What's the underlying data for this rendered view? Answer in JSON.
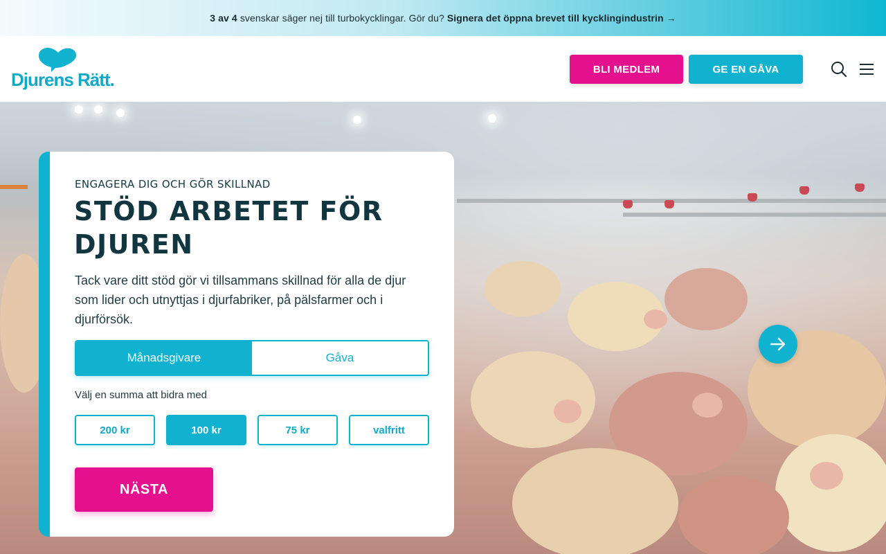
{
  "banner": {
    "lead_bold": "3 av 4",
    "lead_text": "svenskar säger nej till turbokycklingar. Gör du?",
    "link_text": "Signera det öppna brevet till kycklingindustrin →"
  },
  "header": {
    "logo_text": "Djurens Rätt.",
    "member_button": "BLI MEDLEM",
    "gift_button": "GE EN GÅVA",
    "search_icon": "search-icon",
    "menu_icon": "hamburger-menu-icon"
  },
  "card": {
    "kicker": "ENGAGERA DIG OCH GÖR SKILLNAD",
    "headline_line1": "STÖD ARBETET FÖR",
    "headline_line2": "DJUREN",
    "lead": "Tack vare ditt stöd gör vi tillsammans skillnad för alla de djur som lider och utnyttjas i djurfabriker, på pälsfarmer och i djurförsök.",
    "toggle": {
      "options": [
        "Månadsgivare",
        "Gåva"
      ],
      "selected": "Månadsgivare"
    },
    "amount_label": "Välj en summa att bidra med",
    "amounts": [
      "200 kr",
      "100 kr",
      "75 kr",
      "valfritt"
    ],
    "selected_amount": "100 kr",
    "next_button": "NÄSTA"
  },
  "hero": {
    "next_slide_icon": "arrow-right-icon"
  },
  "colors": {
    "brand_cyan": "#10b2cf",
    "brand_pink": "#e5108e",
    "heading_dark": "#12363f"
  }
}
